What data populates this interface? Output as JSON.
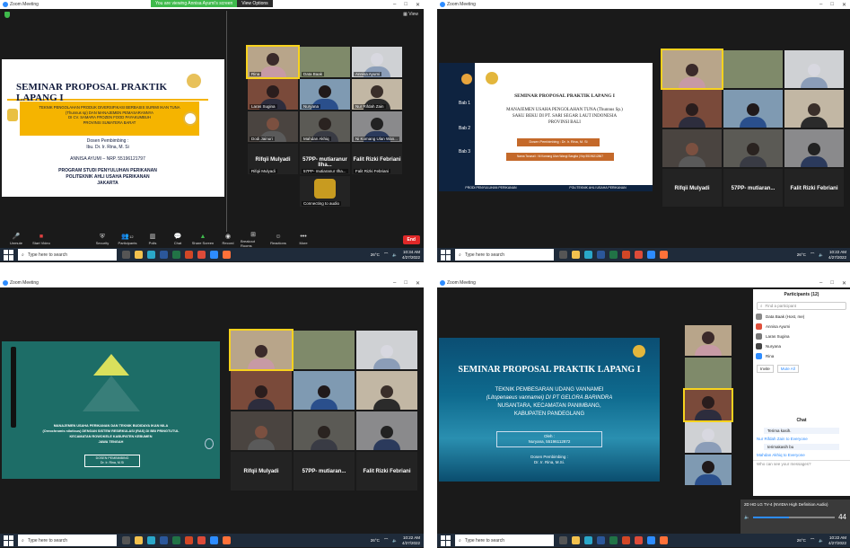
{
  "app": {
    "title": "Zoom Meeting"
  },
  "q1": {
    "share_banner": "You are viewing Annisa Ayumi's screen",
    "view_options": "View Options",
    "view_label": "View",
    "slide": {
      "title": "SEMINAR PROPOSAL PRAKTIK LAPANG I",
      "topic_l1": "TEKNIK PENGOLAHAN PRODUK DIVERSIFIKASI BERBASIS SURIMI IKAN TUNA",
      "topic_l2": "(Thunnus sp) DAN MANAJEMEN PEMASARANNYA",
      "topic_l3": "DI CV. SAMARA FROZEN FOOD PAYAKUMBUH",
      "topic_l4": "PROVINSI SUMATERA BARAT",
      "advisor_label": "Dosen Pembimbing :",
      "advisor": "Ibu. Dr. Ir. Rina, M. Si",
      "student": "ANNISA AYUMI – NRP. 55196121797",
      "program_l1": "PROGRAM STUDI PENYULUHAN PERIKANAN",
      "program_l2": "POLITEKNIK AHLI USAHA PERIKANAN",
      "program_l3": "JAKARTA"
    },
    "tiles": [
      {
        "name": "Rina"
      },
      {
        "name": "Data Baak"
      },
      {
        "name": "Annisa Ayumi"
      },
      {
        "name": "Laras Sugina"
      },
      {
        "name": "Nuryana"
      },
      {
        "name": "Nur Rifdah Zain"
      },
      {
        "name": "Dodi Jainuri"
      },
      {
        "name": "Mahdan Akhiq"
      },
      {
        "name": "Ni Komang Ulan Wan..."
      }
    ],
    "row4": [
      "Rifqii Mulyadi",
      "57PP- mutiaranur Ilha...",
      "Falit Rizki Febriani"
    ],
    "audio_tile": "Connecting to audio",
    "toolbar": [
      "Unmute",
      "Start Video",
      "Security",
      "Participants",
      "Polls",
      "Chat",
      "Share Screen",
      "Record",
      "Breakout Rooms",
      "Reactions",
      "More"
    ],
    "participants_count": "12",
    "end": "End",
    "clock_time": "10:34 AM",
    "clock_date": "4/27/2022"
  },
  "q2": {
    "slide": {
      "title": "SEMINAR PROPOSAL PRAKTIK LAPANG I",
      "topic_l1": "MANAJEMEN USAHA PENGOLAHAN TUNA (Thunnus Sp.)",
      "topic_l2": "SAKU BEKU DI PT. SARI SEGAR LAUT INDONESIA",
      "topic_l3": "PROVINSI BALI",
      "advisor": "Dosen Pembimbing : Dr. Ir. Rina, M. Si",
      "student": "Nama Taruna/i : Ni Komang Ulan Wangi Sasgita | Nrp 55196212867",
      "bab1": "Bab 1",
      "bab2": "Bab 2",
      "bab3": "Bab 3",
      "footer_l": "PRODI PENYULUHAN PERIKANAN",
      "footer_r": "POLITEKNIK AHLI USAHA PERIKANAN"
    },
    "tiles": [
      "",
      "",
      "",
      "",
      "",
      "",
      "",
      "",
      "",
      "Rifqii Mulyadi",
      "57PP- mutiaran...",
      "Falit Rizki Febriani"
    ],
    "clock_time": "10:22 AM",
    "clock_date": "4/27/2022"
  },
  "q3": {
    "slide": {
      "topic_l1": "MANAJEMEN USAHA PERIKANAN DAN TEKNIK BUDIDAYA IKAN NILA",
      "topic_l2": "(Oreochromis niloticus) DENGAN SISTEM RESIRKULASI (RAS) DI BBI PRINGTUTUL",
      "topic_l3": "KECAMATAN ROWOKELE KABUPATEN KEBUMEN",
      "topic_l4": "JAWA TENGAH",
      "advisor_label": "DOSEN PEMBIMBING",
      "advisor": "Dr. Ir. Rina, M.Si"
    },
    "row4": [
      "Rifqii Mulyadi",
      "57PP- mutiaran...",
      "Falit Rizki Febriani"
    ],
    "clock_time": "10:22 AM",
    "clock_date": "4/27/2022"
  },
  "q4": {
    "slide": {
      "title": "SEMINAR PROPOSAL PRAKTIK LAPANG I",
      "topic_l1": "TEKNIK PEMBESARAN UDANG VANNAMEI",
      "topic_l2": "(Litopenaeus vannamei) DI PT GELORA BARINDRA",
      "topic_l3": "NUSANTARA, KECAMATAN PANIMBANG,",
      "topic_l4": "KABUPATEN PANDEGLANG",
      "by_label": "Oleh :",
      "student": "Nuryana, 55196112872",
      "advisor_label": "Dosen Pembimbing :",
      "advisor": "Dr. Ir. Rina, M.Si."
    },
    "participants": {
      "title": "Participants (12)",
      "search_placeholder": "Find a participant",
      "list": [
        "Data Baak (Host, me)",
        "Annisa Ayumi",
        "Laras Sugina",
        "Nuryana",
        "Rina"
      ],
      "invite": "Invite",
      "mute_all": "Mute All"
    },
    "chat": {
      "title": "Chat",
      "msg1": "Terima kasih.",
      "from2": "Nur Rifdah Zain to Everyone",
      "msg2": "terimakasih bu",
      "from3": "Mahdan Akhiq to Everyone",
      "placeholder": "Who can see your messages?"
    },
    "volume": {
      "device": "2D HD LG TV-4 (NVIDIA High Definition Audio)",
      "level": "44"
    },
    "clock_time": "10:22 AM",
    "clock_date": "4/27/2022"
  },
  "taskbar": {
    "search_placeholder": "Type here to search",
    "temp": "26°C"
  },
  "colors": {
    "zoom_blue": "#2d8cff",
    "active_speaker": "#f7d21e",
    "end_red": "#e02828",
    "slide_gold": "#f5b400"
  }
}
